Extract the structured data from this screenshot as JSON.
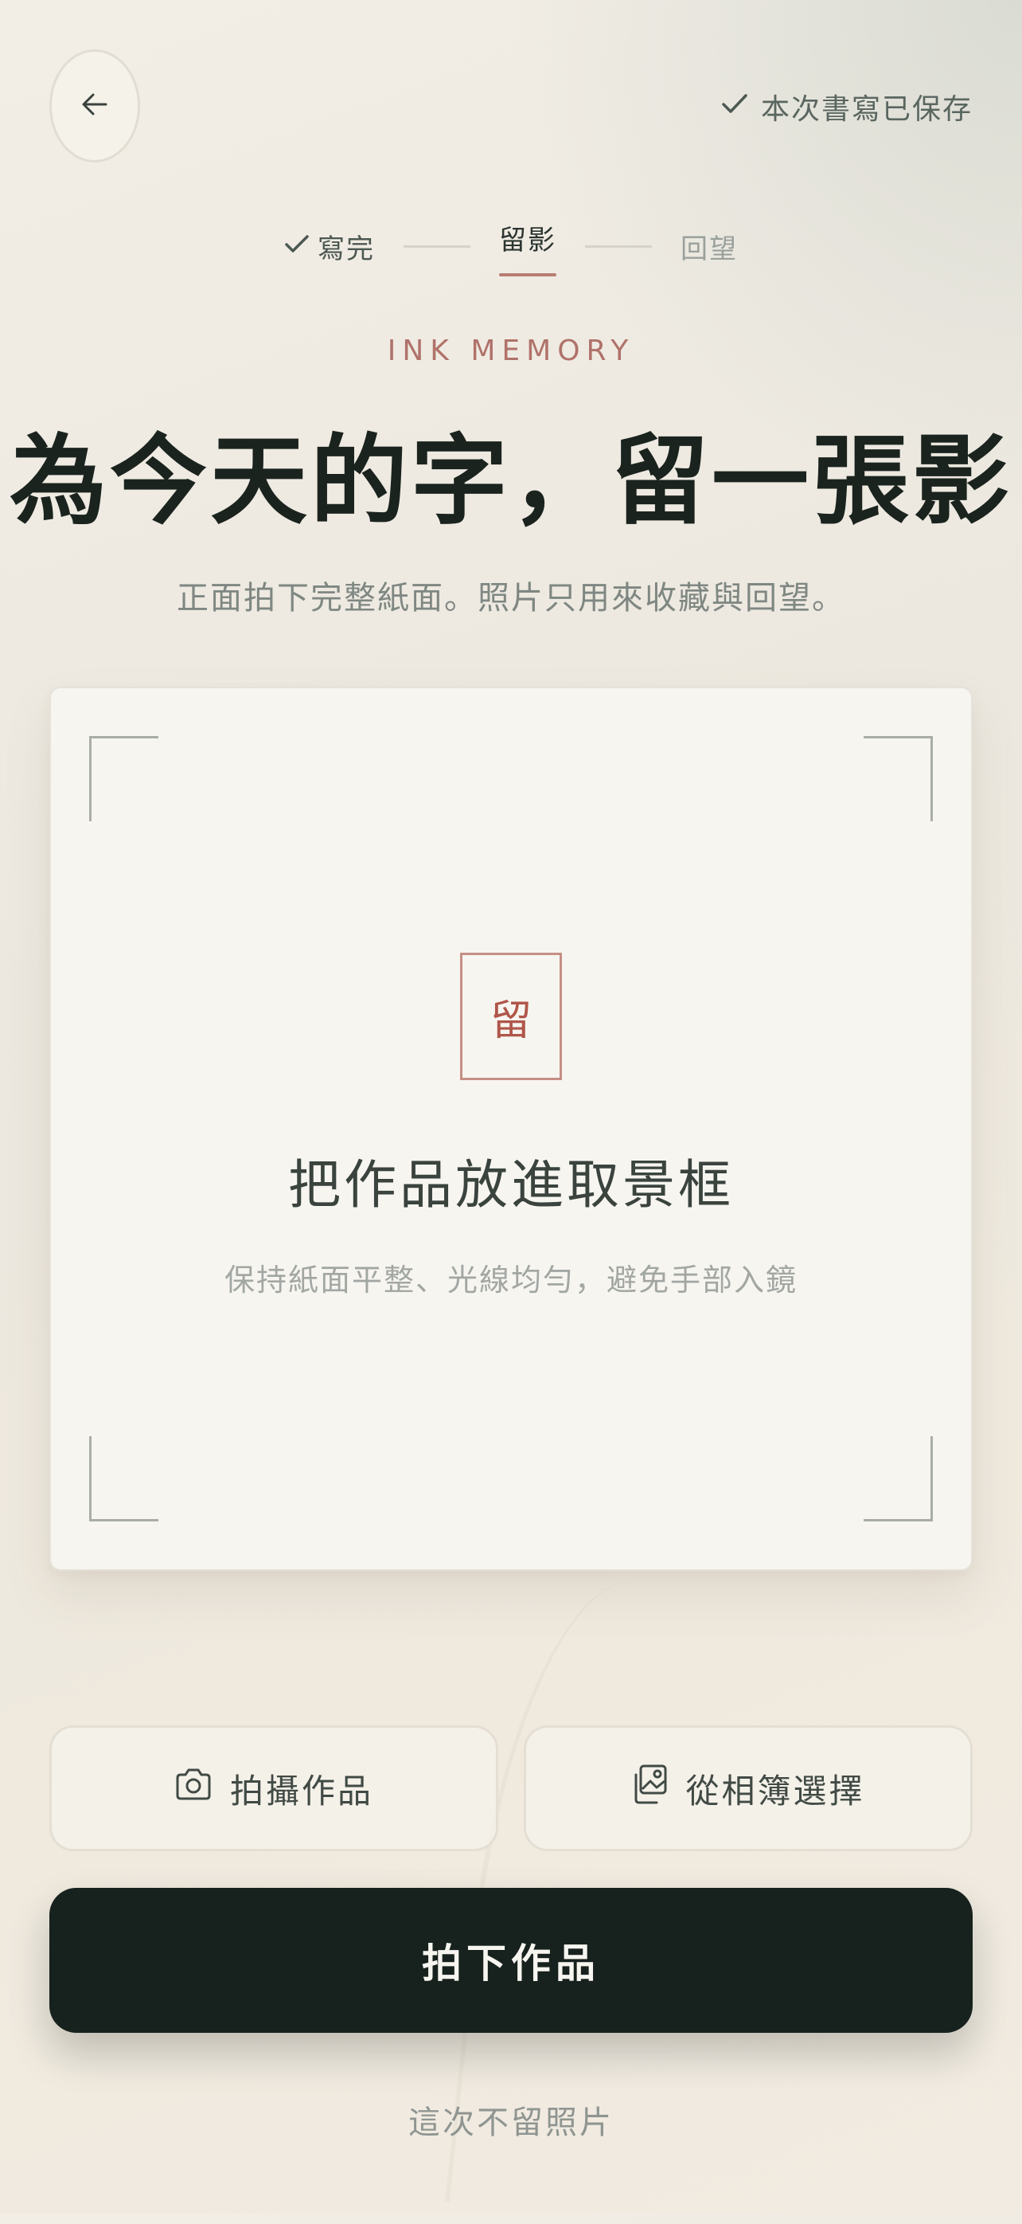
{
  "header": {
    "back_icon": "arrow-left-icon",
    "saved_icon": "check-icon",
    "saved_text": "本次書寫已保存"
  },
  "stepper": {
    "steps": [
      {
        "label": "寫完",
        "state": "done",
        "icon": "check-icon"
      },
      {
        "label": "留影",
        "state": "current"
      },
      {
        "label": "回望",
        "state": "upcoming"
      }
    ]
  },
  "intro": {
    "kicker": "INK MEMORY",
    "title": "為今天的字，留一張影",
    "subtitle": "正面拍下完整紙面。照片只用來收藏與回望。"
  },
  "frame": {
    "seal_char": "留",
    "title": "把作品放進取景框",
    "hint": "保持紙面平整、光線均勻，避免手部入鏡"
  },
  "actions": {
    "camera_icon": "camera-icon",
    "camera_label": "拍攝作品",
    "album_icon": "gallery-icon",
    "album_label": "從相簿選擇",
    "primary_label": "拍下作品",
    "skip_label": "這次不留照片"
  },
  "colors": {
    "accent": "#b0726a",
    "primary_button": "#17211d",
    "background": "#efebe3"
  }
}
